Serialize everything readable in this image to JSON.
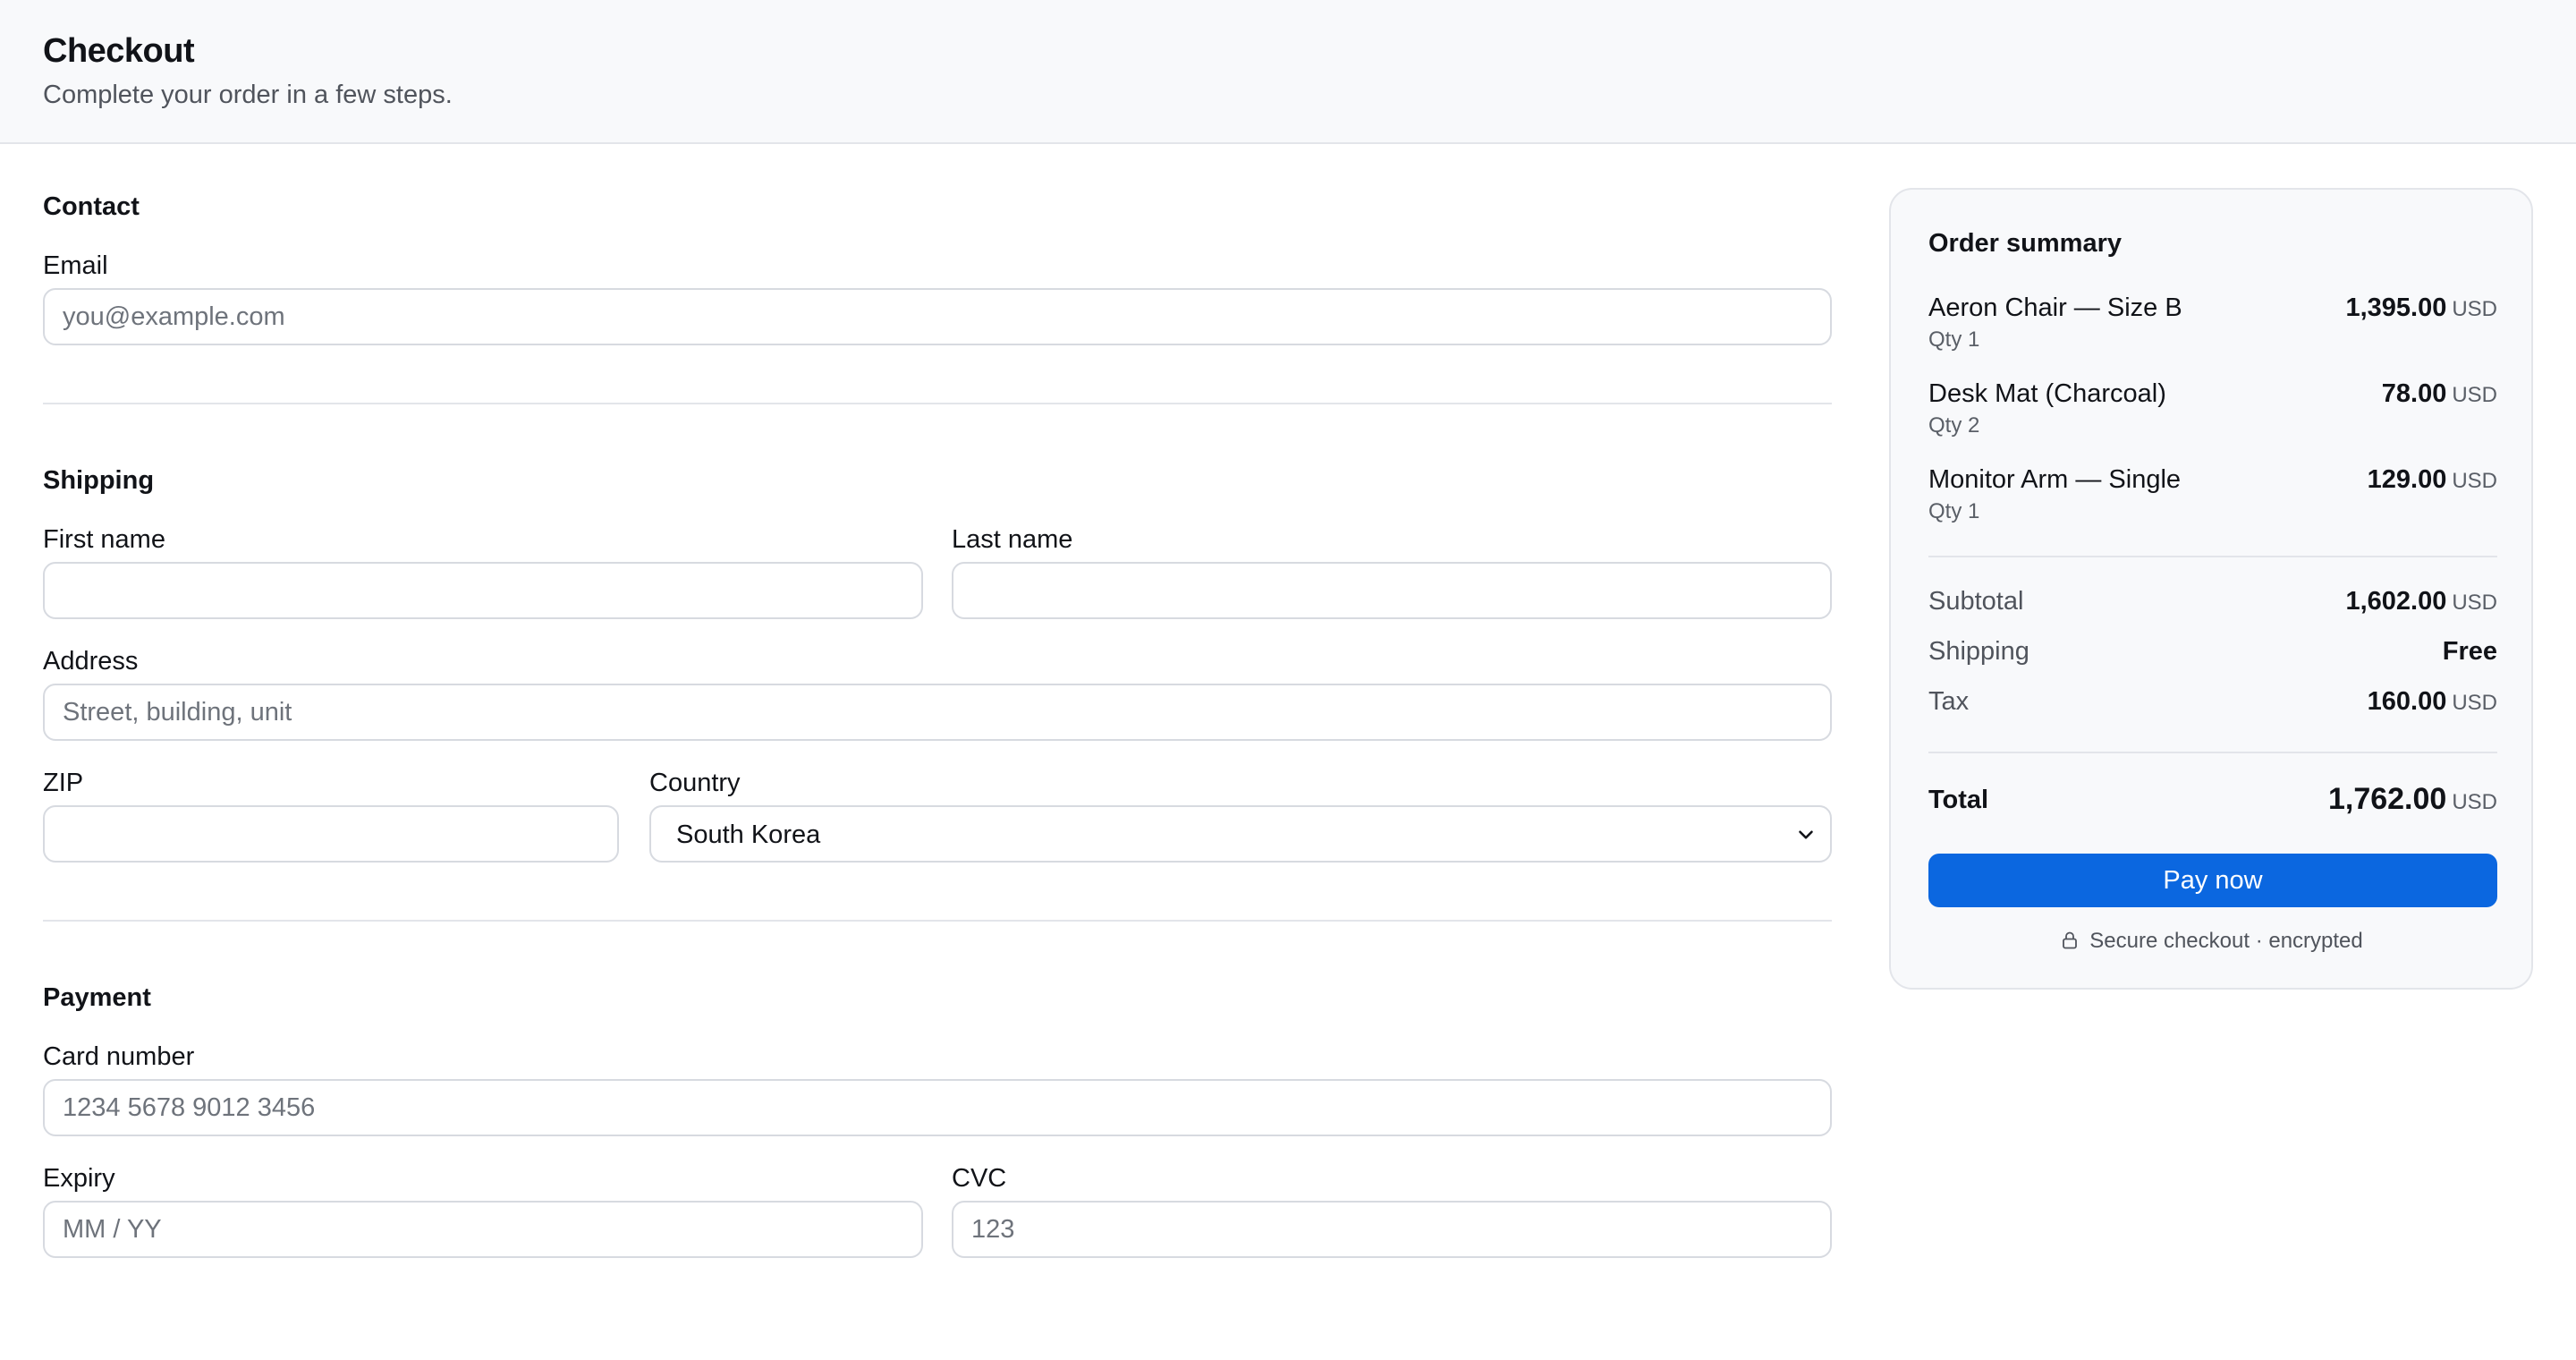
{
  "header": {
    "title": "Checkout",
    "subtitle": "Complete your order in a few steps."
  },
  "contact": {
    "title": "Contact",
    "email_label": "Email",
    "email_placeholder": "you@example.com"
  },
  "shipping": {
    "title": "Shipping",
    "first_name_label": "First name",
    "last_name_label": "Last name",
    "address_label": "Address",
    "address_placeholder": "Street, building, unit",
    "zip_label": "ZIP",
    "country_label": "Country",
    "country_value": "South Korea"
  },
  "payment": {
    "title": "Payment",
    "card_label": "Card number",
    "card_placeholder": "1234 5678 9012 3456",
    "expiry_label": "Expiry",
    "expiry_placeholder": "MM / YY",
    "cvc_label": "CVC",
    "cvc_placeholder": "123"
  },
  "summary": {
    "title": "Order summary",
    "items": [
      {
        "name": "Aeron Chair — Size B",
        "qty": "Qty 1",
        "price": "1,395.00",
        "currency": "USD"
      },
      {
        "name": "Desk Mat (Charcoal)",
        "qty": "Qty 2",
        "price": "78.00",
        "currency": "USD"
      },
      {
        "name": "Monitor Arm — Single",
        "qty": "Qty 1",
        "price": "129.00",
        "currency": "USD"
      }
    ],
    "subtotal_label": "Subtotal",
    "subtotal_value": "1,602.00",
    "shipping_label": "Shipping",
    "shipping_value": "Free",
    "tax_label": "Tax",
    "tax_value": "160.00",
    "total_label": "Total",
    "total_value": "1,762.00",
    "currency": "USD",
    "pay_label": "Pay now",
    "secure_text": "Secure checkout · encrypted",
    "accent_color": "#0b67e0"
  }
}
